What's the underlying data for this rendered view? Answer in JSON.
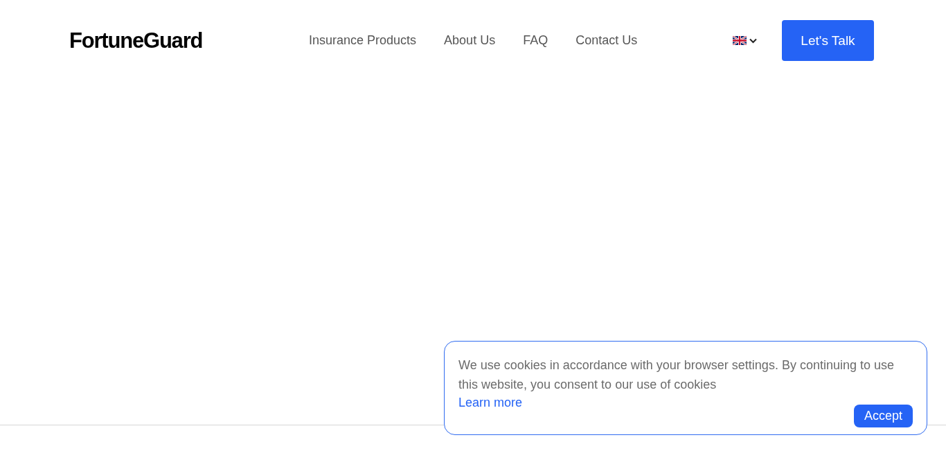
{
  "header": {
    "logo": "FortuneGuard",
    "nav": [
      "Insurance Products",
      "About Us",
      "FAQ",
      "Contact Us"
    ],
    "cta": "Let's Talk"
  },
  "cookie_banner": {
    "message": "We use cookies in accordance with your browser settings. By continuing to use this website, you consent to our use of cookies",
    "link": "Learn more",
    "button": "Accept"
  }
}
